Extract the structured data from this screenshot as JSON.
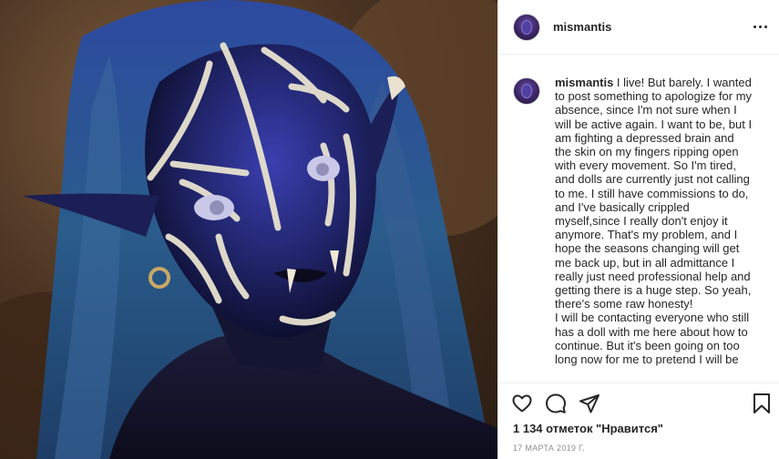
{
  "post": {
    "username": "mismantis",
    "more_icon": "more-horizontal-icon",
    "caption_user": "mismantis",
    "caption_body": " I live! But barely. I wanted to post something to apologize for my absence, since I'm not sure when I will be active again. I want to be, but I am fighting a depressed brain and the skin on my fingers ripping open with every movement. So I'm tired, and dolls are currently just not calling to me. I still have commissions to do, and I've basically crippled myself,since I really don't enjoy it anymore. That's my problem, and I hope the seasons changing will get me back up, but in all admittance I really just need professional help and getting there is a huge step. So yeah, there's some raw honesty!\nI will be contacting everyone who still has a doll with me here about how to continue. But it's been going on too long now for me to pretend I will be",
    "likes": "1 134 отметок \"Нравится\"",
    "date": "17 марта 2019 г."
  },
  "icons": {
    "like": "heart-icon",
    "comment": "comment-icon",
    "share": "paper-plane-icon",
    "save": "bookmark-icon"
  },
  "colors": {
    "hair": "#2b3f7a",
    "skin": "#2a2f7a",
    "paint": "#e8e2cf",
    "background": "#4a3322"
  }
}
